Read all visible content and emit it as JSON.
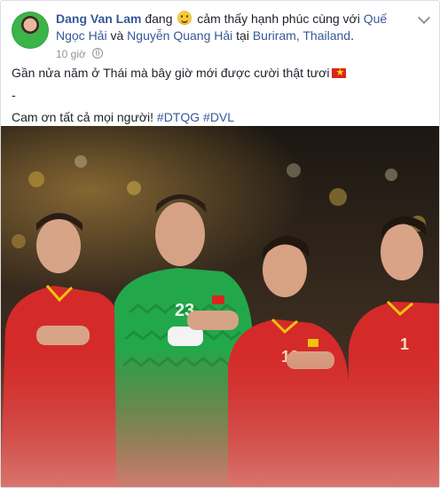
{
  "post": {
    "author": "Dang Van Lam",
    "verb": "đang",
    "feeling": "cảm thấy hạnh phúc",
    "with_word": "cùng với",
    "tag1": "Quế Ngọc Hải",
    "and_word": "và",
    "tag2": "Nguyễn Quang Hải",
    "at_word": "tại",
    "location": "Buriram, Thailand",
    "timestamp": "10 giờ",
    "line1": "Gần nửa năm ở Thái mà bây giờ mới được cười thật tươi",
    "line2": "-",
    "line3": "Cam ơn tất cả mọi người!",
    "hashtag1": "#DTQG",
    "hashtag2": "#DVL",
    "icons": [
      "smiley-feeling-icon",
      "vietnam-flag-icon",
      "globe-icon",
      "chevron-down-icon"
    ],
    "colors": {
      "link": "#365899",
      "meta": "#90949c",
      "text": "#1d2129"
    }
  },
  "photo": {
    "jersey_numbers": [
      "23",
      "19",
      "1"
    ],
    "colors": {
      "home_kit": "#d52a2a",
      "keeper_kit": "#22a84a",
      "trim": "#f1c40f"
    }
  }
}
